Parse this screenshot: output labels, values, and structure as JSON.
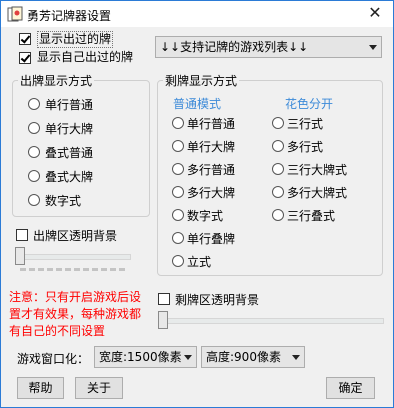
{
  "window": {
    "title": "勇芳记牌器设置",
    "close_glyph": "✕"
  },
  "top": {
    "show_played": {
      "label": "显示出过的牌",
      "checked": true
    },
    "show_own_played": {
      "label": "显示自己出过的牌",
      "checked": true
    },
    "games_dropdown": {
      "value": "↓↓支持记牌的游戏列表↓↓"
    }
  },
  "played_display": {
    "legend": "出牌显示方式",
    "options": [
      "单行普通",
      "单行大牌",
      "叠式普通",
      "叠式大牌",
      "数字式"
    ],
    "transparent_bg": {
      "label": "出牌区透明背景",
      "checked": false
    },
    "slider_value": 0
  },
  "remaining_display": {
    "legend": "剩牌显示方式",
    "normal_header": "普通模式",
    "suit_header": "花色分开",
    "normal_options": [
      "单行普通",
      "单行大牌",
      "多行普通",
      "多行大牌",
      "数字式",
      "单行叠牌",
      "立式"
    ],
    "suit_options": [
      "三行式",
      "多行式",
      "三行大牌式",
      "多行大牌式",
      "三行叠式"
    ],
    "transparent_bg": {
      "label": "剩牌区透明背景",
      "checked": false
    },
    "slider_value": 0
  },
  "note": {
    "lines": [
      "注意：只有开启游戏后设",
      "置才有效果，每种游戏都",
      "有自己的不同设置"
    ]
  },
  "window_size": {
    "label": "游戏窗口化：",
    "width_value": "宽度:1500像素",
    "height_value": "高度:900像素"
  },
  "buttons": {
    "help": "帮助",
    "about": "关于",
    "ok": "确定"
  }
}
